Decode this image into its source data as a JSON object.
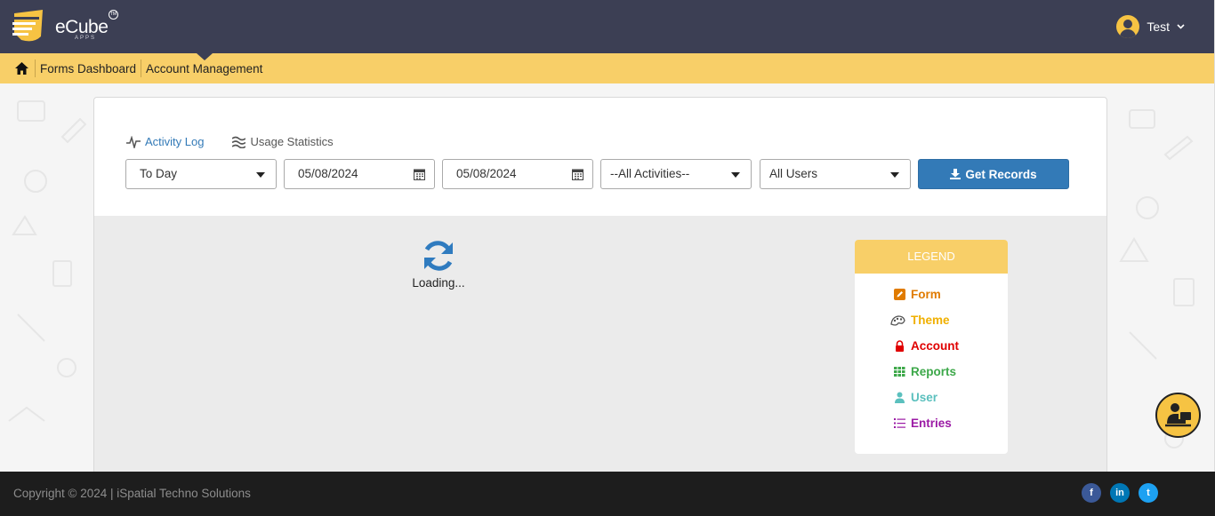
{
  "header": {
    "brand_name": "eCube",
    "brand_sub": "APPS",
    "brand_tm": "TM",
    "user_name": "Test"
  },
  "breadcrumb": {
    "items": [
      "Forms Dashboard",
      "Account Management"
    ]
  },
  "tabs": [
    {
      "label": "Activity Log",
      "icon": "activity-icon",
      "active": true
    },
    {
      "label": "Usage Statistics",
      "icon": "stats-icon",
      "active": false
    }
  ],
  "filters": {
    "period": "To Day",
    "from_date": "05/08/2024",
    "to_date": "05/08/2024",
    "activity": "--All Activities--",
    "users": "All Users",
    "get_records_label": "Get Records"
  },
  "loader": {
    "text": "Loading..."
  },
  "legend": {
    "title": "LEGEND",
    "items": [
      {
        "label": "Form",
        "color": "#e07b00",
        "icon": "form-icon"
      },
      {
        "label": "Theme",
        "color": "#f0b000",
        "icon": "theme-icon"
      },
      {
        "label": "Account",
        "color": "#e00000",
        "icon": "lock-icon"
      },
      {
        "label": "Reports",
        "color": "#3da84a",
        "icon": "grid-icon"
      },
      {
        "label": "User",
        "color": "#5bc0be",
        "icon": "user-icon"
      },
      {
        "label": "Entries",
        "color": "#9b1aa5",
        "icon": "list-icon"
      }
    ]
  },
  "footer": {
    "copyright": "Copyright © 2024 | iSpatial Techno Solutions",
    "social": [
      {
        "label": "f",
        "color": "#3b5998",
        "icon": "facebook-icon"
      },
      {
        "label": "in",
        "color": "#0077b5",
        "icon": "linkedin-icon"
      },
      {
        "label": "t",
        "color": "#1da1f2",
        "icon": "twitter-icon"
      }
    ]
  },
  "colors": {
    "header_bg": "#3c3f54",
    "accent_yellow": "#f8cf68",
    "primary_blue": "#337ab7",
    "footer_bg": "#1d1d1d"
  }
}
